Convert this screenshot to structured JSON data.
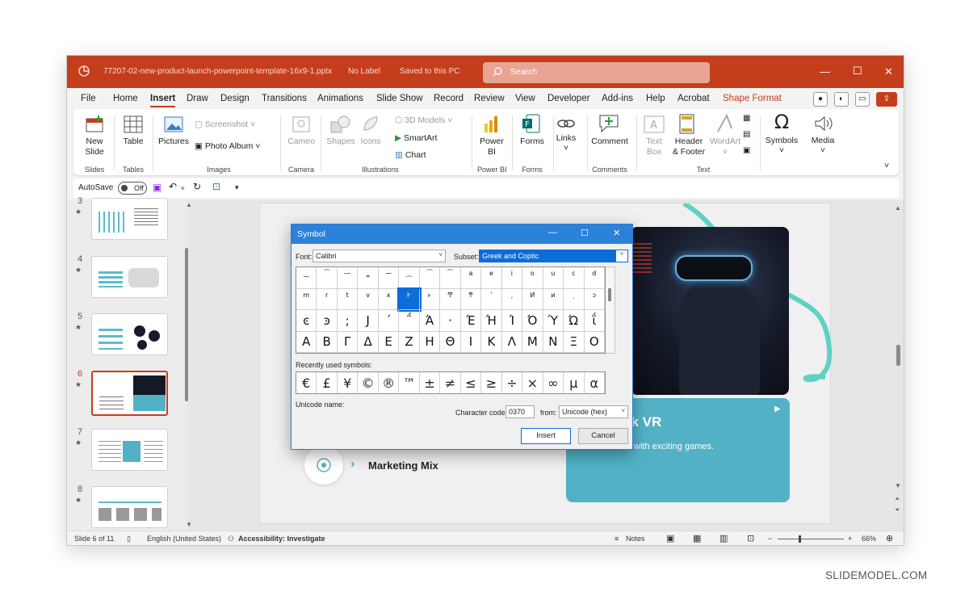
{
  "window": {
    "file_name": "77207-02-new-product-launch-powerpoint-template-16x9-1.pptx",
    "label_status": "No Label",
    "save_status": "Saved to this PC",
    "search_placeholder": "Search"
  },
  "menu": [
    "File",
    "Home",
    "Insert",
    "Draw",
    "Design",
    "Transitions",
    "Animations",
    "Slide Show",
    "Record",
    "Review",
    "View",
    "Developer",
    "Add-ins",
    "Help",
    "Acrobat",
    "Shape Format"
  ],
  "ribbon": {
    "new_slide": [
      "New",
      "Slide"
    ],
    "table": "Table",
    "pictures": "Pictures",
    "screenshot": "Screenshot",
    "photo_album": "Photo Album",
    "cameo": "Cameo",
    "shapes": "Shapes",
    "icons": "Icons",
    "models3d": "3D Models",
    "smartart": "SmartArt",
    "chart": "Chart",
    "powerbi": [
      "Power",
      "BI"
    ],
    "forms": "Forms",
    "links": "Links",
    "comment": "Comment",
    "textbox": [
      "Text",
      "Box"
    ],
    "header_footer": [
      "Header",
      "& Footer"
    ],
    "wordart": "WordArt",
    "symbols": "Symbols",
    "media": "Media",
    "groups": [
      "Slides",
      "Tables",
      "Images",
      "Camera",
      "Illustrations",
      "Power BI",
      "Forms",
      "Comments",
      "Text"
    ]
  },
  "qat": {
    "autosave": "AutoSave",
    "toggle": "Off"
  },
  "thumbnails": [
    {
      "num": "3"
    },
    {
      "num": "4"
    },
    {
      "num": "5"
    },
    {
      "num": "6"
    },
    {
      "num": "7"
    },
    {
      "num": "8"
    }
  ],
  "slide": {
    "card_heading": "ek VR",
    "card_sub": "with exciting games.",
    "marketing_mix": "Marketing Mix"
  },
  "status": {
    "slide_pos": "Slide 6 of 11",
    "language": "English (United States)",
    "accessibility": "Accessibility: Investigate",
    "notes": "Notes",
    "zoom": "66%"
  },
  "dialog": {
    "title": "Symbol",
    "font_label": "Font:",
    "font_value": "Calibri",
    "subset_label": "Subset:",
    "subset_value": "Greek and Coptic",
    "grid": [
      [
        "‿",
        "⁀",
        "―",
        "‗",
        "⁓",
        "⁔",
        "⁀",
        "⁀",
        "a",
        "e",
        "i",
        "o",
        "u",
        "c",
        "d"
      ],
      [
        "m",
        "r",
        "t",
        "v",
        "x",
        "Ͱ",
        "ͱ",
        "Ͳ",
        "ͳ",
        "ʹ",
        "͵",
        "Ͷ",
        "ͷ",
        "ͺ",
        "ͻ"
      ],
      [
        "ͼ",
        "ͽ",
        ";",
        "Ϳ",
        "΄",
        "΅",
        "Ά",
        "·",
        "Έ",
        "Ή",
        "Ί",
        "Ό",
        "Ύ",
        "Ώ",
        "ΐ"
      ],
      [
        "Α",
        "Β",
        "Γ",
        "Δ",
        "Ε",
        "Ζ",
        "Η",
        "Θ",
        "Ι",
        "Κ",
        "Λ",
        "Μ",
        "Ν",
        "Ξ",
        "Ο"
      ]
    ],
    "recent_label": "Recently used symbols:",
    "recent": [
      "€",
      "£",
      "¥",
      "©",
      "®",
      "™",
      "±",
      "≠",
      "≤",
      "≥",
      "÷",
      "×",
      "∞",
      "μ",
      "α"
    ],
    "unicode_name_label": "Unicode name:",
    "char_code_label": "Character code:",
    "char_code": "0370",
    "from_label": "from:",
    "from_value": "Unicode (hex)",
    "insert": "Insert",
    "cancel": "Cancel"
  },
  "brand": "SLIDEMODEL.COM"
}
